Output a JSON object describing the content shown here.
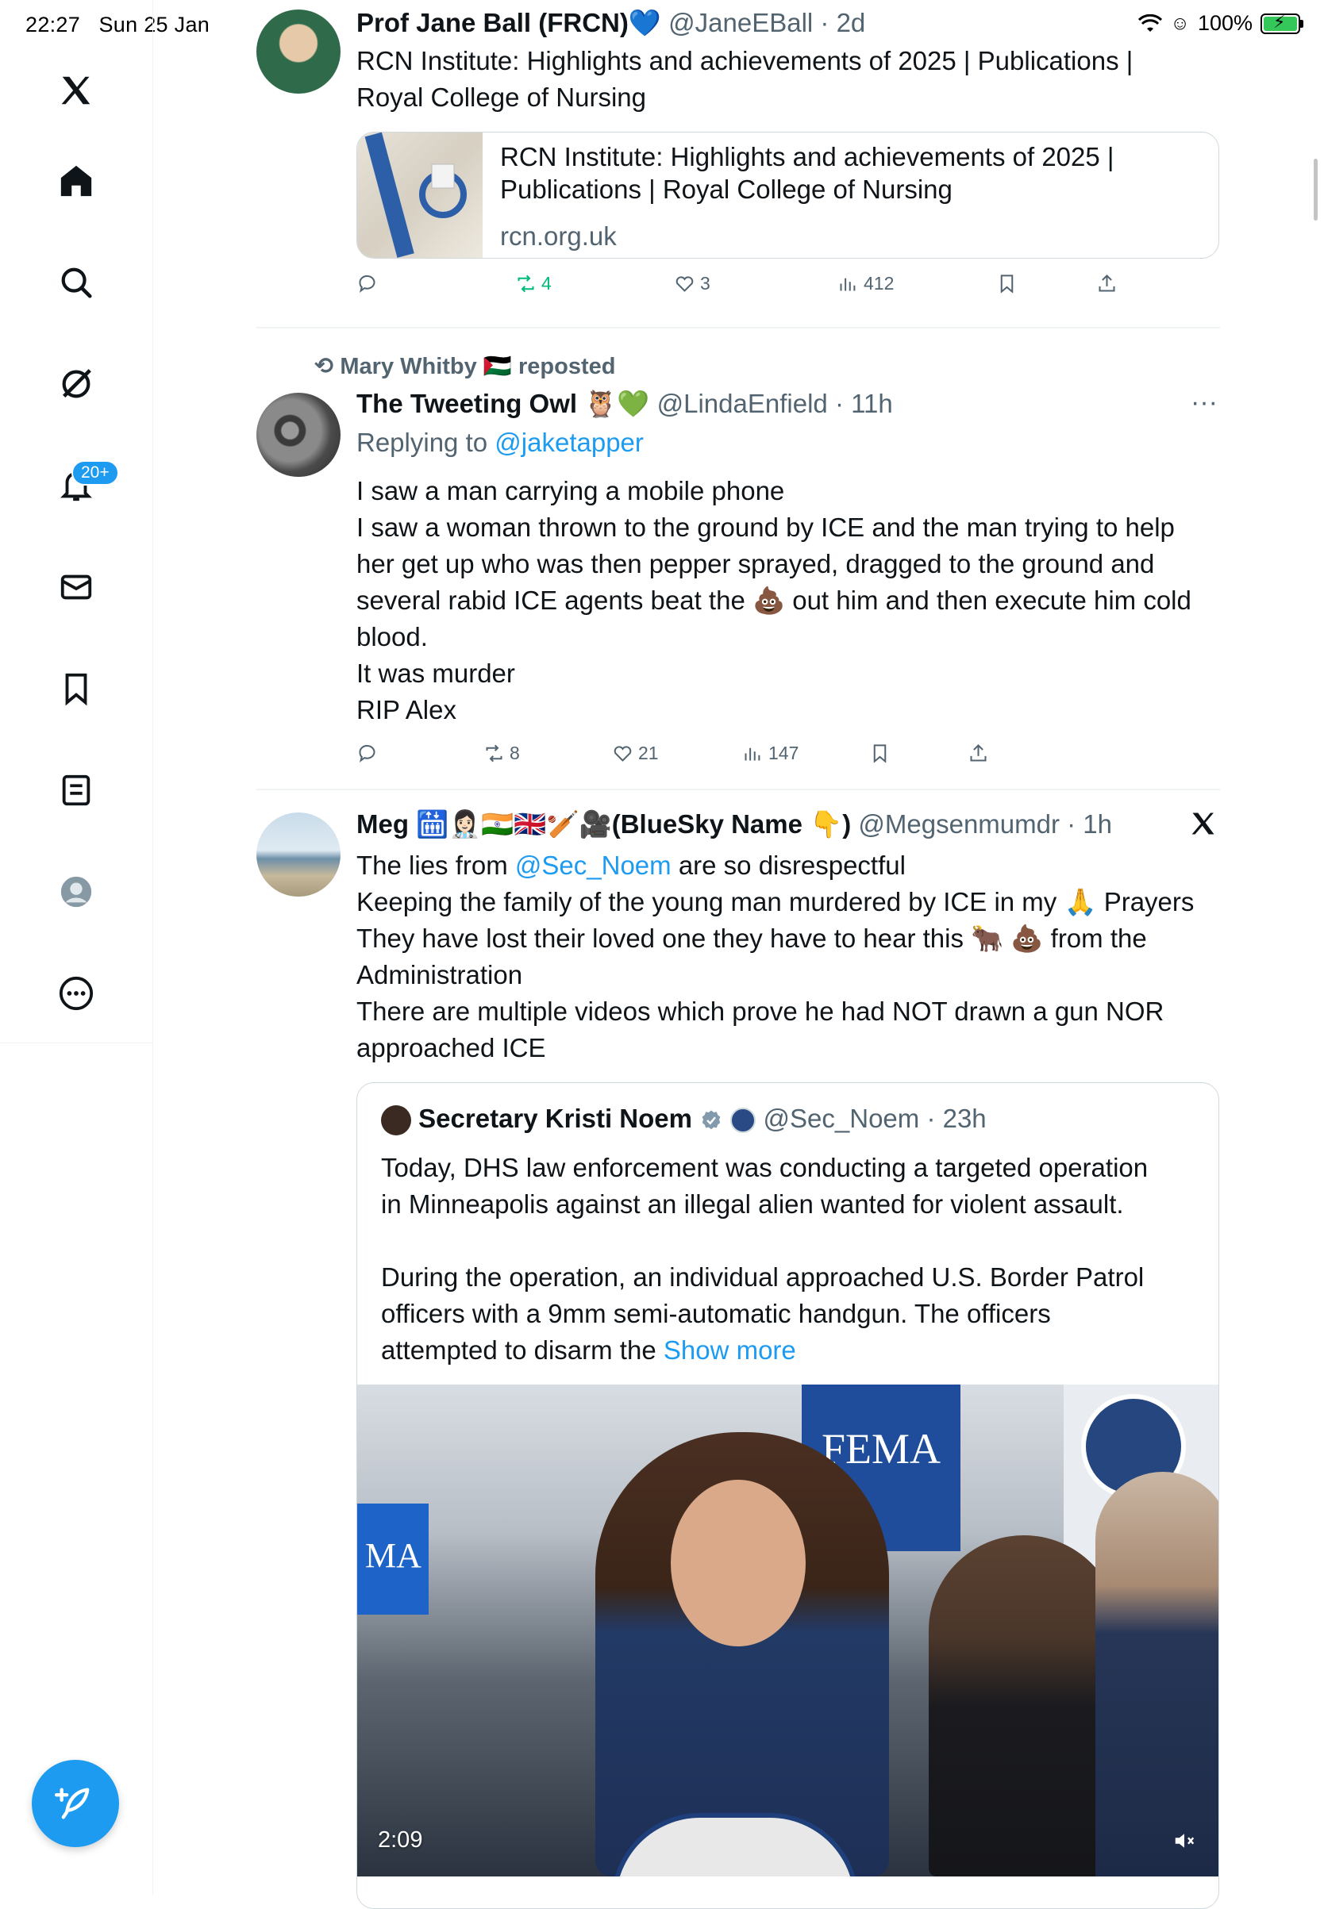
{
  "status_bar": {
    "time": "22:27",
    "date": "Sun 25 Jan",
    "battery": "100%",
    "battery_level": 1.0
  },
  "nav": {
    "items": [
      "home",
      "search",
      "grok",
      "notifications",
      "messages",
      "bookmarks",
      "lists",
      "profile",
      "more"
    ],
    "notifications_badge": "20+"
  },
  "tweet1": {
    "name": "Prof Jane Ball (FRCN)",
    "name_emoji": "💙",
    "handle": "@JaneEBall",
    "time": "· 2d",
    "text_line1": "RCN Institute: Highlights and achievements of 2025 | Publications |",
    "text_line2": "Royal College of Nursing",
    "card": {
      "title_line1": "RCN Institute: Highlights and achievements of 2025 |",
      "title_line2": "Publications | Royal College of Nursing",
      "domain": "rcn.org.uk"
    },
    "stats": {
      "replies": "",
      "reposts": "4",
      "likes": "3",
      "views": "412"
    }
  },
  "tweet2": {
    "repost_by": "Mary Whitby 🇵🇸 reposted",
    "name": "The Tweeting Owl",
    "name_emoji": "🦉💚",
    "handle": "@LindaEnfield",
    "time": "· 11h",
    "replying_prefix": "Replying to",
    "replying_to": "@jaketapper",
    "lines": [
      "I saw a man carrying a mobile phone",
      "I saw a woman thrown to the ground by ICE and the man trying to help",
      "her get up who was then pepper sprayed, dragged to the ground and",
      "several rabid ICE agents beat the 💩 out him and then execute him cold",
      "blood.",
      "It was murder",
      "RIP Alex"
    ],
    "stats": {
      "replies": "",
      "reposts": "8",
      "likes": "21",
      "views": "147"
    }
  },
  "tweet3": {
    "name": "Meg 🛗👩🏻‍⚕️🇮🇳🇬🇧🏏🎥(BlueSky Name 👇)",
    "handle": "@Megsenmumdr",
    "time": "· 1h",
    "line1_prefix": "The lies from",
    "line1_mention": "@Sec_Noem",
    "line1_suffix": "are so disrespectful",
    "lines": [
      "Keeping the family of the young man murdered by ICE in my 🙏 Prayers",
      "They have lost their loved one they have to hear this 🐂 💩 from the",
      "Administration",
      "There are multiple videos which prove he had NOT drawn a gun NOR",
      "approached ICE"
    ],
    "quote": {
      "name": "Secretary Kristi Noem",
      "handle": "@Sec_Noem",
      "time": "· 23h",
      "lines": [
        "Today, DHS law enforcement was conducting a targeted operation",
        "in Minneapolis against an illegal alien wanted for violent assault.",
        "",
        "During the operation, an individual approached U.S. Border Patrol",
        "officers with a 9mm semi-automatic handgun. The officers"
      ],
      "last_line": "attempted to disarm the",
      "show_more": "Show more",
      "video": {
        "duration": "2:09",
        "sign_fema": "FEMA",
        "sign_left": "MA"
      }
    }
  },
  "colors": {
    "accent": "#1d9bf0",
    "repost_green": "#00ba7c",
    "muted": "#536471"
  }
}
